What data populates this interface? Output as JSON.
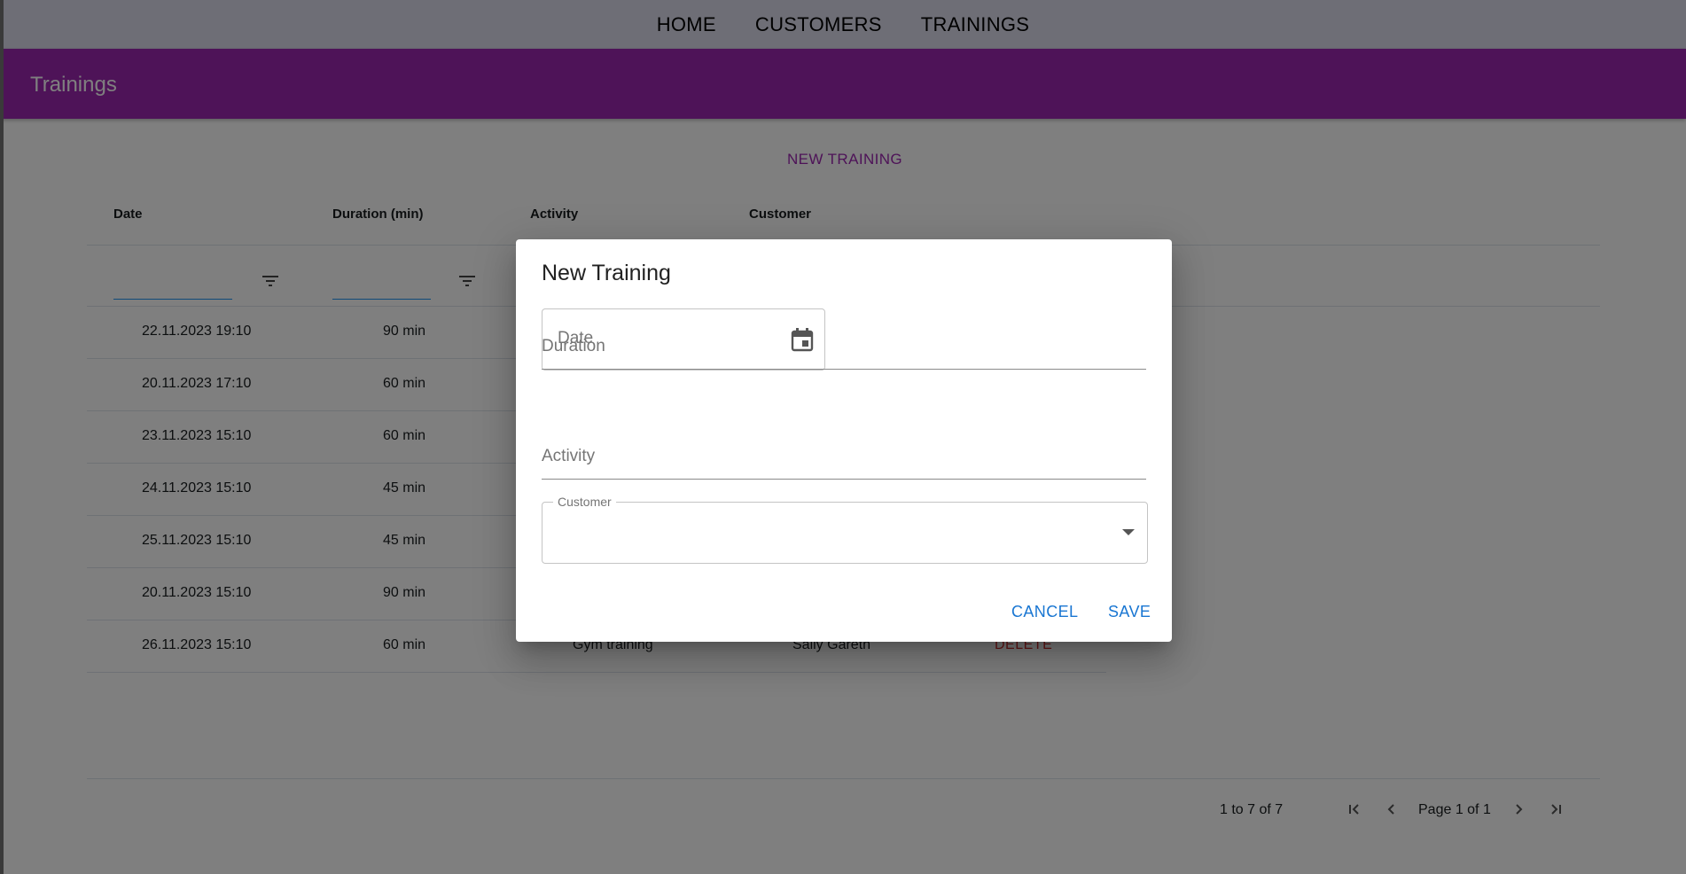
{
  "nav": {
    "items": [
      "HOME",
      "CUSTOMERS",
      "TRAININGS"
    ]
  },
  "appbar": {
    "title": "Trainings"
  },
  "actions": {
    "new_training": "NEW TRAINING"
  },
  "grid": {
    "columns": [
      "Date",
      "Duration (min)",
      "Activity",
      "Customer"
    ],
    "rows": [
      {
        "date": "22.11.2023 19:10",
        "duration": "90 min"
      },
      {
        "date": "20.11.2023 17:10",
        "duration": "60 min"
      },
      {
        "date": "23.11.2023 15:10",
        "duration": "60 min"
      },
      {
        "date": "24.11.2023 15:10",
        "duration": "45 min"
      },
      {
        "date": "25.11.2023 15:10",
        "duration": "45 min"
      },
      {
        "date": "20.11.2023 15:10",
        "duration": "90 min"
      },
      {
        "date": "26.11.2023 15:10",
        "duration": "60 min",
        "activity": "Gym training",
        "customer": "Sally Gareth",
        "delete": "DELETE"
      }
    ],
    "pagination": {
      "summary": "1 to 7 of 7",
      "page_label": "Page 1 of 1"
    }
  },
  "dialog": {
    "title": "New Training",
    "date_placeholder": "Date",
    "duration_placeholder": "Duration",
    "activity_placeholder": "Activity",
    "customer_label": "Customer",
    "cancel": "CANCEL",
    "save": "SAVE"
  },
  "colors": {
    "primary": "#9c27b0",
    "nav_bg": "#dcdcec",
    "button": "#1976d2",
    "danger": "#d32f2f"
  },
  "icons": [
    "filter-icon",
    "calendar-icon",
    "chevron-down-icon",
    "first-page-icon",
    "previous-page-icon",
    "next-page-icon",
    "last-page-icon"
  ]
}
